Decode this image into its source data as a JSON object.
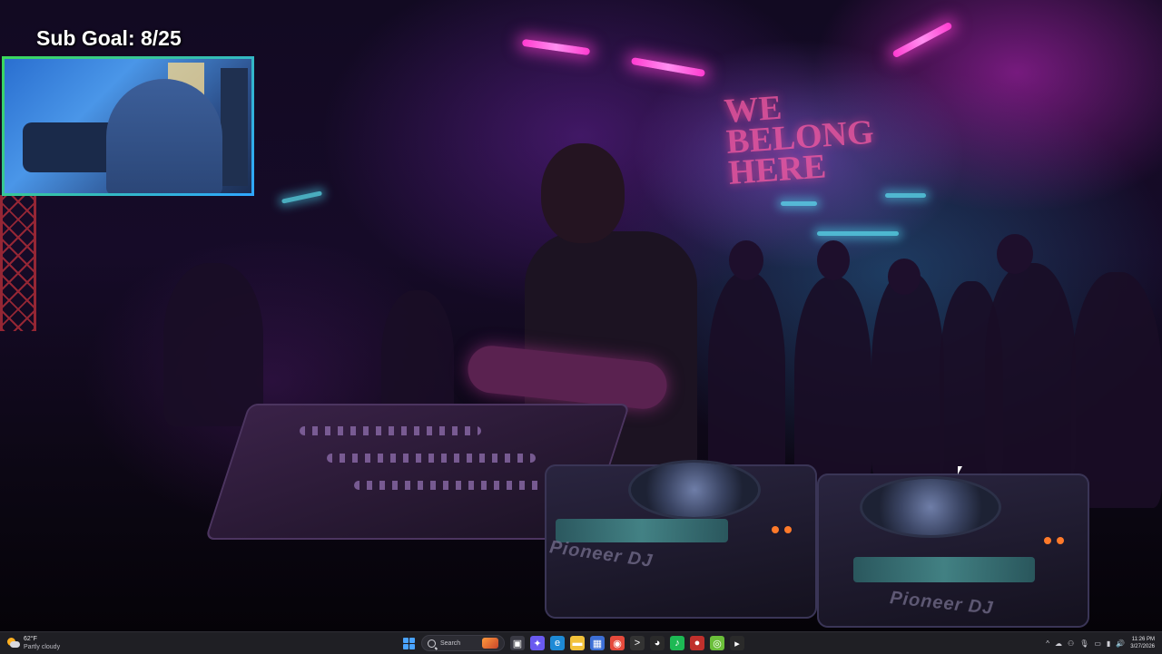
{
  "overlay": {
    "sub_goal": "Sub Goal: 8/25"
  },
  "scene": {
    "neon_sign": "WE BELONG HERE",
    "deck_brand_left": "Pioneer DJ",
    "deck_brand_right": "Pioneer DJ"
  },
  "taskbar": {
    "weather_temp": "62°F",
    "weather_condition": "Partly cloudy",
    "search_label": "Search",
    "clock_time": "11:26 PM",
    "clock_date": "3/27/2026",
    "pinned_apps": [
      {
        "name": "task-view-icon",
        "color": "#3a3a44",
        "glyph": "▣"
      },
      {
        "name": "copilot-icon",
        "color": "#6a5af0",
        "glyph": "✦"
      },
      {
        "name": "edge-icon",
        "color": "#1e8ad6",
        "glyph": "e"
      },
      {
        "name": "file-explorer-icon",
        "color": "#f2c23a",
        "glyph": "▬"
      },
      {
        "name": "store-icon",
        "color": "#3d6fd6",
        "glyph": "▦"
      },
      {
        "name": "chrome-icon",
        "color": "#e54a3c",
        "glyph": "◉"
      },
      {
        "name": "terminal-icon",
        "color": "#333",
        "glyph": ">"
      },
      {
        "name": "github-icon",
        "color": "#2a2a2a",
        "glyph": "◕"
      },
      {
        "name": "spotify-icon",
        "color": "#1db954",
        "glyph": "♪"
      },
      {
        "name": "obs-icon",
        "color": "#c0302c",
        "glyph": "●"
      },
      {
        "name": "app-icon",
        "color": "#6bbf3a",
        "glyph": "◎"
      },
      {
        "name": "nvidia-icon",
        "color": "#2a2a2a",
        "glyph": "▸"
      }
    ],
    "tray_glyphs": [
      "^",
      "☁",
      "⚇",
      "🎙",
      "▭",
      "▮",
      "🔊"
    ]
  }
}
